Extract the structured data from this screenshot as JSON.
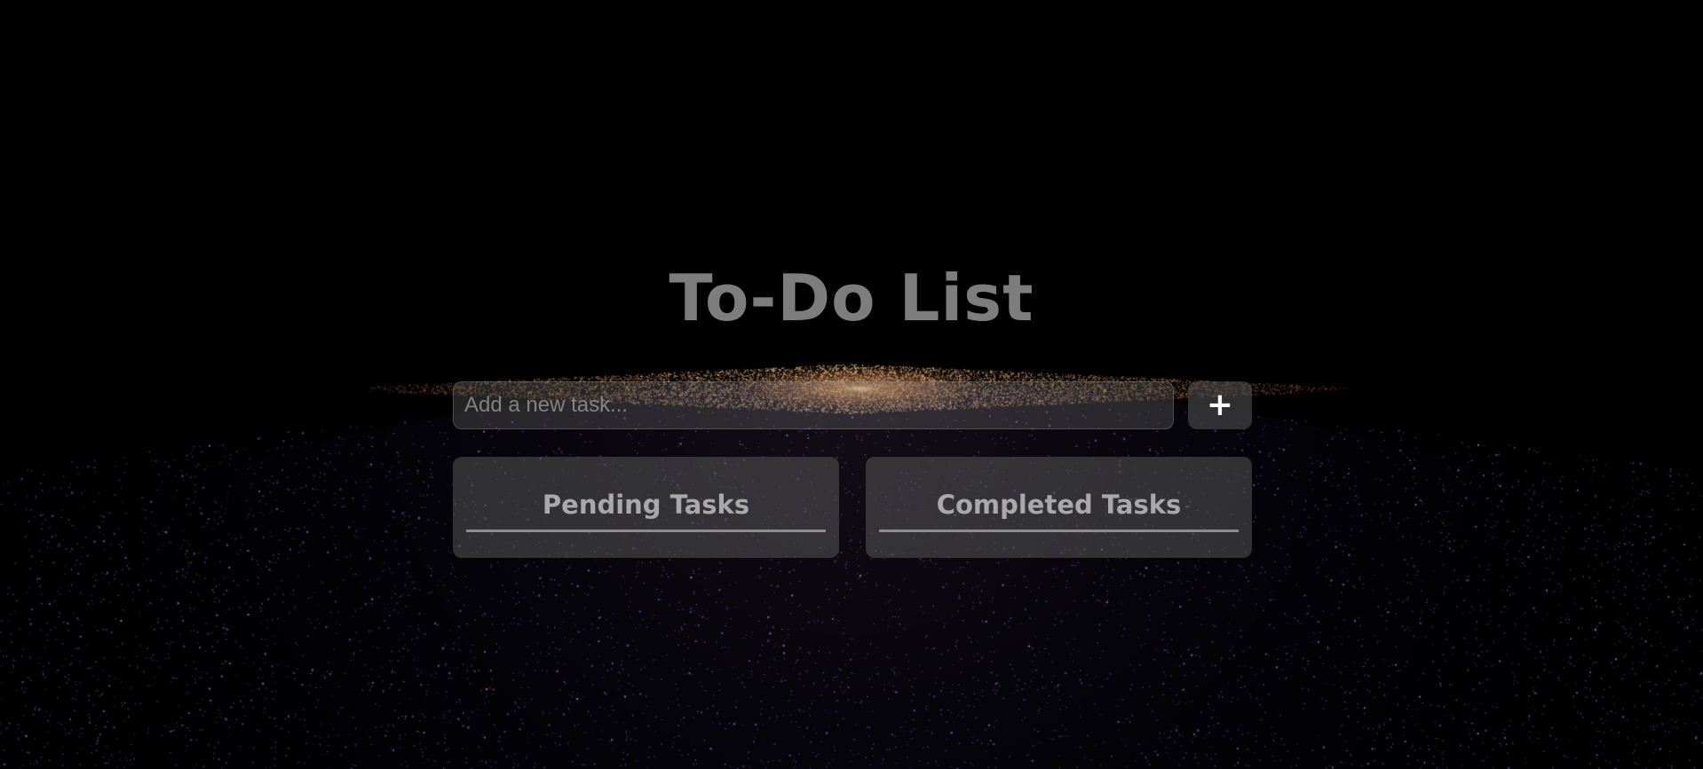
{
  "app": {
    "title": "To-Do List"
  },
  "input": {
    "placeholder": "Add a new task...",
    "value": ""
  },
  "add_button": {
    "label": "+",
    "icon": "plus-icon"
  },
  "panels": {
    "pending": {
      "heading": "Pending Tasks",
      "items": []
    },
    "completed": {
      "heading": "Completed Tasks",
      "items": []
    }
  },
  "colors": {
    "background": "#000000",
    "title": "#7d7d7d",
    "panel_heading": "#a9a9a9",
    "galaxy_core": "#ffb070",
    "stars": "#6a5acd"
  }
}
